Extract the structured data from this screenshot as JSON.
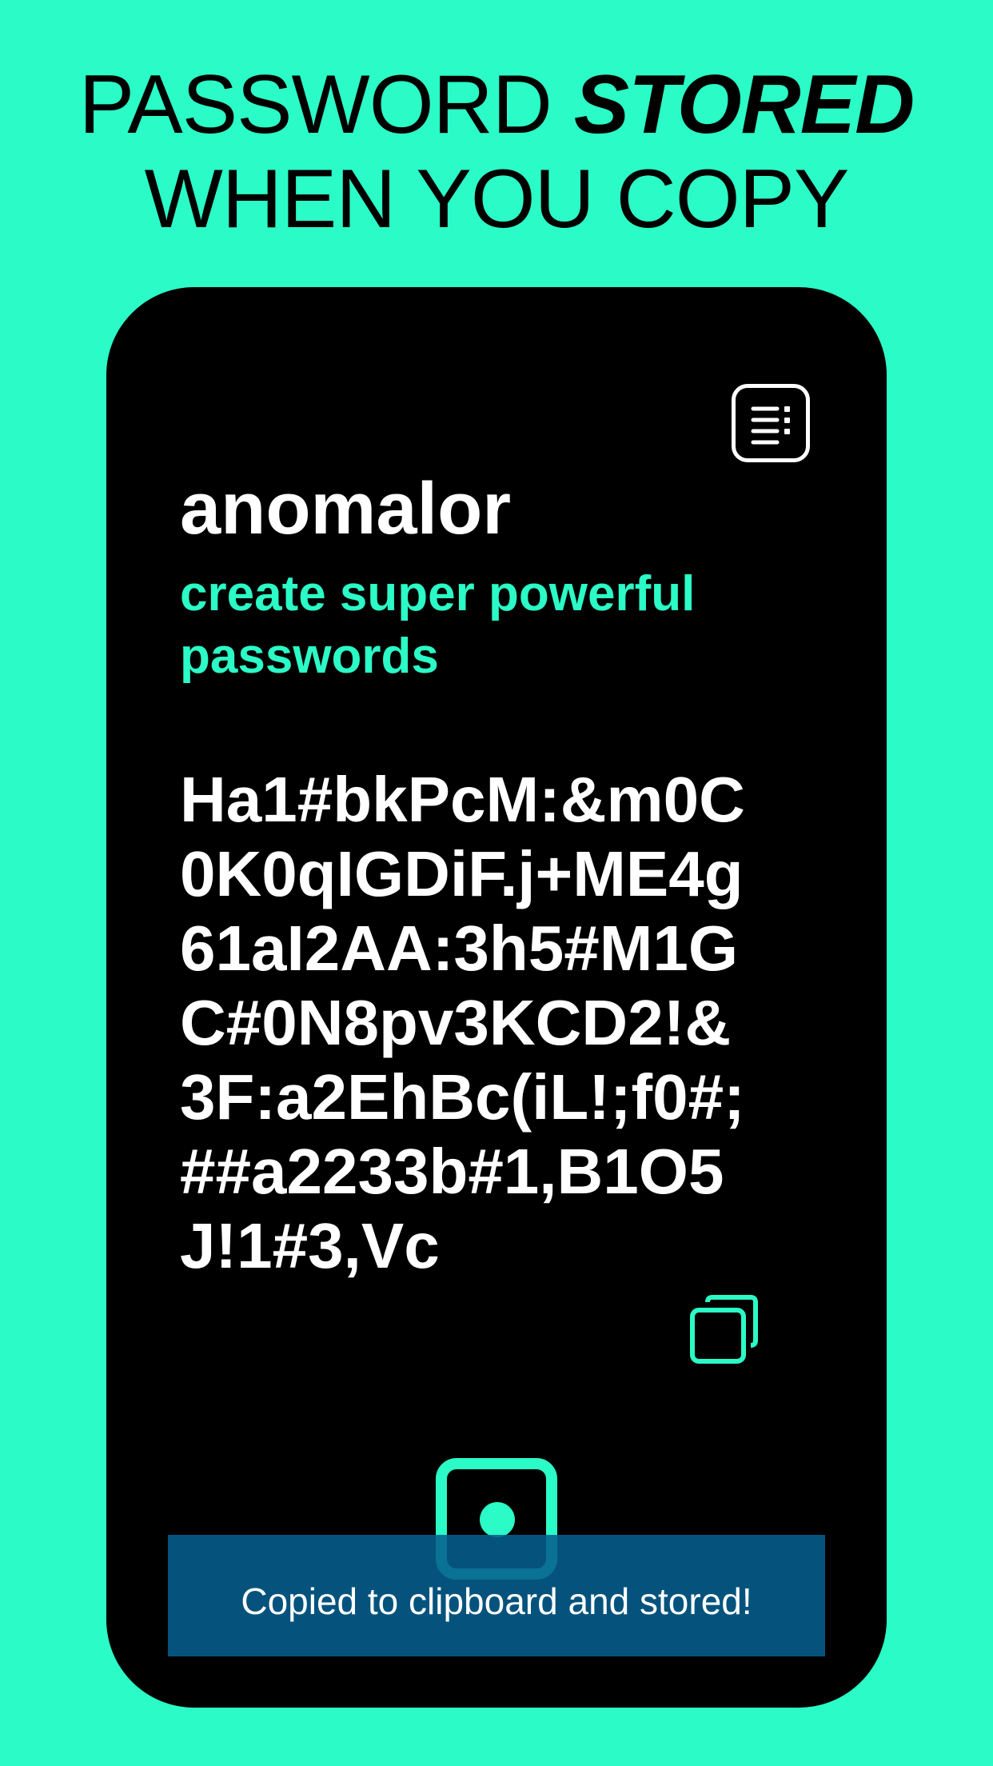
{
  "headline": {
    "line1_regular": "PASSWORD ",
    "line1_emphasis": "STORED",
    "line2": "WHEN YOU COPY"
  },
  "app": {
    "name": "anomalor",
    "tagline": "create super powerful passwords",
    "password_lines": [
      "Ha1#bkPcM:&m0C",
      "0K0qIGDiF.j+ME4g",
      "61aI2AA:3h5#M1G",
      "C#0N8pv3KCD2!&",
      "3F:a2EhBc(iL!;f0#;",
      "##a2233b#1,B1O5",
      "J!1#3,Vc"
    ]
  },
  "toast": {
    "message": "Copied to clipboard and stored!"
  },
  "icons": {
    "menu": "list-menu-icon",
    "copy": "copy-icon",
    "generate": "generate-icon"
  },
  "colors": {
    "background": "#2bfbc6",
    "accent": "#2bfbc6",
    "phone": "#000000",
    "toast": "#065f8e"
  }
}
